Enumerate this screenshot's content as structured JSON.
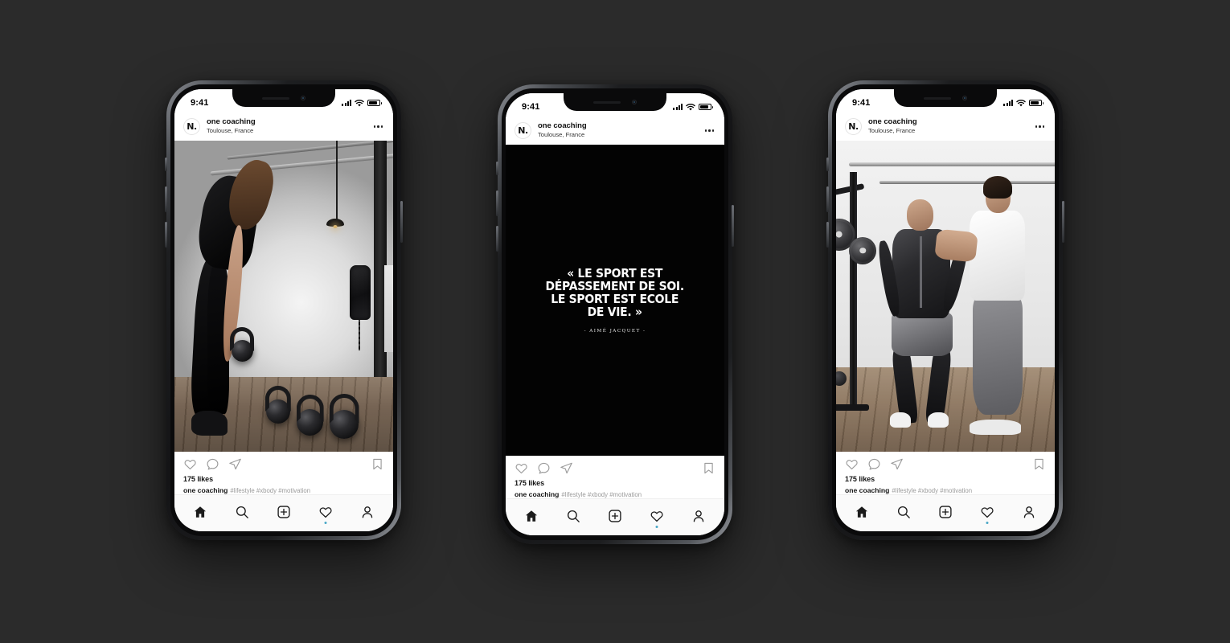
{
  "background_color": "#2b2b2b",
  "status_bar": {
    "time": "9:41",
    "icons": [
      "signal-icon",
      "wifi-icon",
      "battery-icon"
    ]
  },
  "post": {
    "account_name": "one coaching",
    "location": "Toulouse, France",
    "avatar_mark": "N.",
    "more_label": "•••",
    "likes": "175 likes",
    "caption_user": "one coaching",
    "caption_tags": "#lifestyle #xbody #motivation",
    "actions": [
      "heart-icon",
      "comment-icon",
      "share-icon",
      "bookmark-icon"
    ]
  },
  "tab_bar": {
    "items": [
      {
        "name": "home",
        "active": true
      },
      {
        "name": "search",
        "active": false
      },
      {
        "name": "add",
        "active": false
      },
      {
        "name": "activity",
        "active": false,
        "badge": true
      },
      {
        "name": "profile",
        "active": false
      }
    ],
    "badge_color": "#4aa8c6"
  },
  "phones": [
    {
      "id": "phone-1",
      "media_type": "photo",
      "media_description": "Woman in black athletic wear bending over holding a kettlebell in an industrial gym, kettlebells on wooden floor"
    },
    {
      "id": "phone-2",
      "media_type": "quote-card",
      "quote_line_1": "« LE SPORT EST",
      "quote_line_2": "DÉPASSEMENT DE SOI.",
      "quote_line_3": "LE SPORT EST ECOLE",
      "quote_line_4": "DE VIE. »",
      "quote_author": "- AIMÉ JACQUET -",
      "card_background": "#030303",
      "card_text_color": "#ffffff"
    },
    {
      "id": "phone-3",
      "media_type": "photo",
      "media_description": "Coach in white t-shirt adjusting EMS training suit on athlete in a bright gym with weight rack"
    }
  ]
}
